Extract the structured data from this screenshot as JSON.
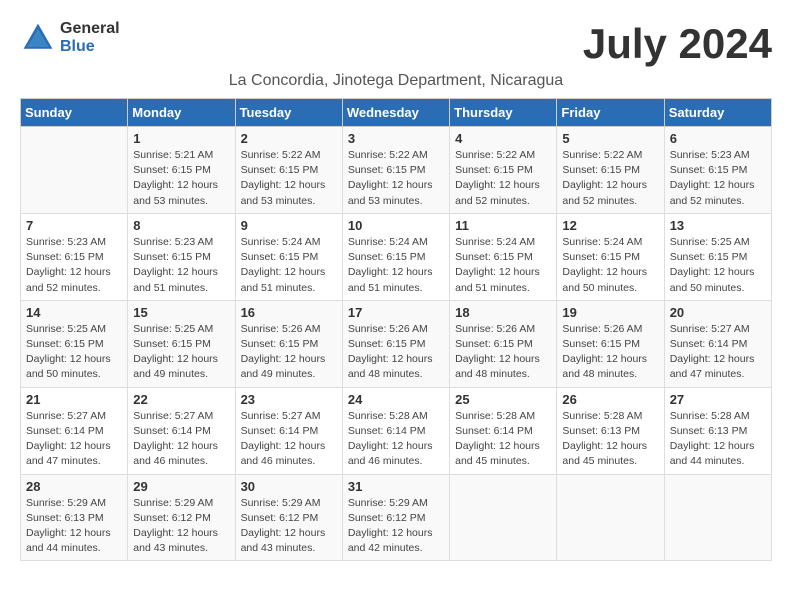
{
  "header": {
    "logo_general": "General",
    "logo_blue": "Blue",
    "month_year": "July 2024",
    "location": "La Concordia, Jinotega Department, Nicaragua"
  },
  "weekdays": [
    "Sunday",
    "Monday",
    "Tuesday",
    "Wednesday",
    "Thursday",
    "Friday",
    "Saturday"
  ],
  "weeks": [
    [
      {
        "day": "",
        "info": ""
      },
      {
        "day": "1",
        "info": "Sunrise: 5:21 AM\nSunset: 6:15 PM\nDaylight: 12 hours\nand 53 minutes."
      },
      {
        "day": "2",
        "info": "Sunrise: 5:22 AM\nSunset: 6:15 PM\nDaylight: 12 hours\nand 53 minutes."
      },
      {
        "day": "3",
        "info": "Sunrise: 5:22 AM\nSunset: 6:15 PM\nDaylight: 12 hours\nand 53 minutes."
      },
      {
        "day": "4",
        "info": "Sunrise: 5:22 AM\nSunset: 6:15 PM\nDaylight: 12 hours\nand 52 minutes."
      },
      {
        "day": "5",
        "info": "Sunrise: 5:22 AM\nSunset: 6:15 PM\nDaylight: 12 hours\nand 52 minutes."
      },
      {
        "day": "6",
        "info": "Sunrise: 5:23 AM\nSunset: 6:15 PM\nDaylight: 12 hours\nand 52 minutes."
      }
    ],
    [
      {
        "day": "7",
        "info": "Sunrise: 5:23 AM\nSunset: 6:15 PM\nDaylight: 12 hours\nand 52 minutes."
      },
      {
        "day": "8",
        "info": "Sunrise: 5:23 AM\nSunset: 6:15 PM\nDaylight: 12 hours\nand 51 minutes."
      },
      {
        "day": "9",
        "info": "Sunrise: 5:24 AM\nSunset: 6:15 PM\nDaylight: 12 hours\nand 51 minutes."
      },
      {
        "day": "10",
        "info": "Sunrise: 5:24 AM\nSunset: 6:15 PM\nDaylight: 12 hours\nand 51 minutes."
      },
      {
        "day": "11",
        "info": "Sunrise: 5:24 AM\nSunset: 6:15 PM\nDaylight: 12 hours\nand 51 minutes."
      },
      {
        "day": "12",
        "info": "Sunrise: 5:24 AM\nSunset: 6:15 PM\nDaylight: 12 hours\nand 50 minutes."
      },
      {
        "day": "13",
        "info": "Sunrise: 5:25 AM\nSunset: 6:15 PM\nDaylight: 12 hours\nand 50 minutes."
      }
    ],
    [
      {
        "day": "14",
        "info": "Sunrise: 5:25 AM\nSunset: 6:15 PM\nDaylight: 12 hours\nand 50 minutes."
      },
      {
        "day": "15",
        "info": "Sunrise: 5:25 AM\nSunset: 6:15 PM\nDaylight: 12 hours\nand 49 minutes."
      },
      {
        "day": "16",
        "info": "Sunrise: 5:26 AM\nSunset: 6:15 PM\nDaylight: 12 hours\nand 49 minutes."
      },
      {
        "day": "17",
        "info": "Sunrise: 5:26 AM\nSunset: 6:15 PM\nDaylight: 12 hours\nand 48 minutes."
      },
      {
        "day": "18",
        "info": "Sunrise: 5:26 AM\nSunset: 6:15 PM\nDaylight: 12 hours\nand 48 minutes."
      },
      {
        "day": "19",
        "info": "Sunrise: 5:26 AM\nSunset: 6:15 PM\nDaylight: 12 hours\nand 48 minutes."
      },
      {
        "day": "20",
        "info": "Sunrise: 5:27 AM\nSunset: 6:14 PM\nDaylight: 12 hours\nand 47 minutes."
      }
    ],
    [
      {
        "day": "21",
        "info": "Sunrise: 5:27 AM\nSunset: 6:14 PM\nDaylight: 12 hours\nand 47 minutes."
      },
      {
        "day": "22",
        "info": "Sunrise: 5:27 AM\nSunset: 6:14 PM\nDaylight: 12 hours\nand 46 minutes."
      },
      {
        "day": "23",
        "info": "Sunrise: 5:27 AM\nSunset: 6:14 PM\nDaylight: 12 hours\nand 46 minutes."
      },
      {
        "day": "24",
        "info": "Sunrise: 5:28 AM\nSunset: 6:14 PM\nDaylight: 12 hours\nand 46 minutes."
      },
      {
        "day": "25",
        "info": "Sunrise: 5:28 AM\nSunset: 6:14 PM\nDaylight: 12 hours\nand 45 minutes."
      },
      {
        "day": "26",
        "info": "Sunrise: 5:28 AM\nSunset: 6:13 PM\nDaylight: 12 hours\nand 45 minutes."
      },
      {
        "day": "27",
        "info": "Sunrise: 5:28 AM\nSunset: 6:13 PM\nDaylight: 12 hours\nand 44 minutes."
      }
    ],
    [
      {
        "day": "28",
        "info": "Sunrise: 5:29 AM\nSunset: 6:13 PM\nDaylight: 12 hours\nand 44 minutes."
      },
      {
        "day": "29",
        "info": "Sunrise: 5:29 AM\nSunset: 6:12 PM\nDaylight: 12 hours\nand 43 minutes."
      },
      {
        "day": "30",
        "info": "Sunrise: 5:29 AM\nSunset: 6:12 PM\nDaylight: 12 hours\nand 43 minutes."
      },
      {
        "day": "31",
        "info": "Sunrise: 5:29 AM\nSunset: 6:12 PM\nDaylight: 12 hours\nand 42 minutes."
      },
      {
        "day": "",
        "info": ""
      },
      {
        "day": "",
        "info": ""
      },
      {
        "day": "",
        "info": ""
      }
    ]
  ]
}
